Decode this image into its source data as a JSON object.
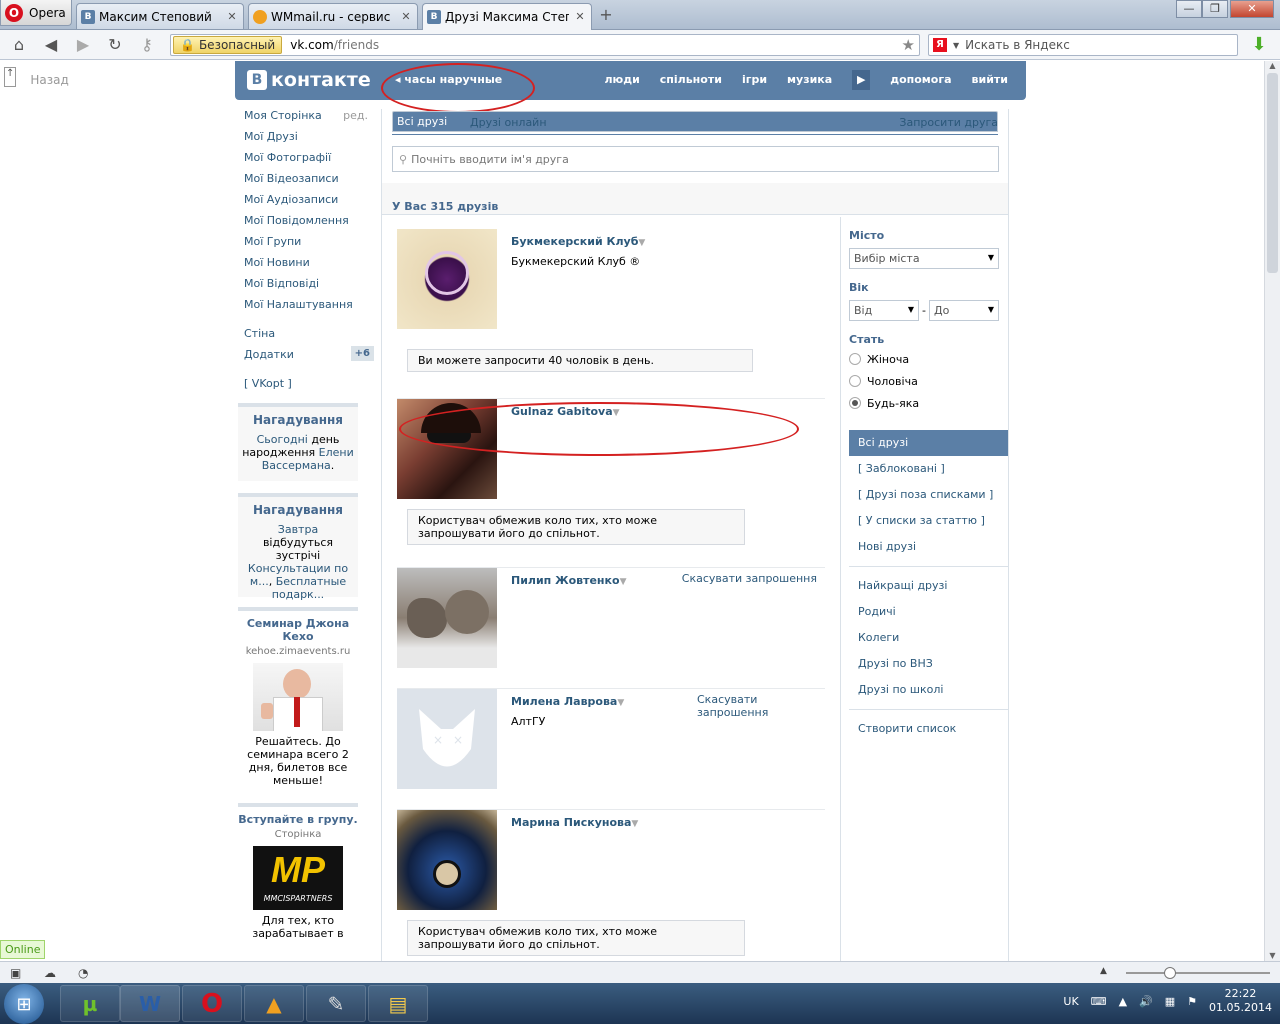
{
  "browser": {
    "opera_label": "Opera",
    "tabs": [
      {
        "title": "Максим Степовий",
        "favicon": "vk-icon",
        "fav_text": "В",
        "color": "#5b7fa6"
      },
      {
        "title": "WMmail.ru - сервис п...",
        "favicon": "wmmail-icon",
        "fav_text": "",
        "color": "#f0a020"
      },
      {
        "title": "Друзі Максима Степо...",
        "favicon": "vk-icon",
        "fav_text": "В",
        "color": "#5b7fa6"
      }
    ],
    "secure_label": "Безопасный",
    "url_host": "vk.com",
    "url_path": "/friends",
    "search_placeholder": "Искать в Яндекс"
  },
  "page": {
    "back_label": "Назад",
    "header": {
      "logo_text": "контакте",
      "logo_badge": "В",
      "status": "часы наручные",
      "nav": [
        "люди",
        "спільноти",
        "ігри",
        "музика",
        "допомога",
        "вийти"
      ]
    },
    "left_menu": {
      "items": [
        "Моя Сторінка",
        "Мої Друзі",
        "Мої Фотографії",
        "Мої Відеозаписи",
        "Мої Аудіозаписи",
        "Мої Повідомлення",
        "Мої Групи",
        "Мої Новини",
        "Мої Відповіді",
        "Мої Налаштування"
      ],
      "edit_label": "ред.",
      "items2": [
        "Стіна",
        "Додатки"
      ],
      "apps_badge": "+6",
      "vkopt": "[ VKopt ]"
    },
    "reminder1": {
      "title": "Нагадування",
      "l1": "Сьогодні",
      "l2": "день народження",
      "l3": "Елени Вассермана",
      "l4": "."
    },
    "reminder2": {
      "title": "Нагадування",
      "l1": "Завтра",
      "l2": "відбудуться зустрічі",
      "l3": "Консультации по м...",
      "l4": ",",
      "l5": "Бесплатные подарк..."
    },
    "ad1": {
      "title": "Семинар Джона Кехо",
      "url": "kehoe.zimaevents.ru",
      "text": "Решайтесь. До семинара всего 2 дня, билетов все меньше!"
    },
    "ad2": {
      "title": "Вступайте в групу.",
      "sub": "Сторінка",
      "logo": "MP",
      "logo_sub": "MMCISPARTNERS",
      "text": "Для тех, кто зарабатывает в"
    },
    "tabs": {
      "all": "Всі друзі",
      "online": "Друзі онлайн",
      "invite": "Запросити друга"
    },
    "search_placeholder": "Почніть вводити ім'я друга",
    "count_label": "У Вас 315 друзів",
    "friends": [
      {
        "name": "Букмекерский Клуб",
        "sub": "Букмекерский Клуб ®",
        "action": "",
        "notice": "Ви можете запросити 40 чоловік в день."
      },
      {
        "name": "Gulnaz Gabitova",
        "sub": "",
        "action": "",
        "notice": "Користувач обмежив коло тих, хто може запрошувати його до спільнот."
      },
      {
        "name": "Пилип Жовтенко",
        "sub": "",
        "action": "Скасувати запрошення",
        "notice": ""
      },
      {
        "name": "Милена Лаврова",
        "sub": "АлтГУ",
        "action": "Скасувати запрошення",
        "notice": ""
      },
      {
        "name": "Марина Пискунова",
        "sub": "",
        "action": "",
        "notice": "Користувач обмежив коло тих, хто може запрошувати його до спільнот."
      }
    ],
    "filter": {
      "city_label": "Місто",
      "city_value": "Вибір міста",
      "age_label": "Вік",
      "age_from": "Від",
      "age_to": "До",
      "age_sep": "-",
      "sex_label": "Стать",
      "sex_options": [
        "Жіноча",
        "Чоловіча",
        "Будь-яка"
      ],
      "sex_selected": 2,
      "lists_a": [
        "Всі друзі",
        "[ Заблоковані ]",
        "[ Друзі поза списками ]",
        "[ У списки за статтю ]",
        "Нові друзі"
      ],
      "lists_b": [
        "Найкращі друзі",
        "Родичі",
        "Колеги",
        "Друзі по ВНЗ",
        "Друзі по школі"
      ],
      "create_list": "Створити список"
    },
    "online_badge": "Online"
  },
  "taskbar": {
    "lang": "UK",
    "time": "22:22",
    "date": "01.05.2014"
  }
}
